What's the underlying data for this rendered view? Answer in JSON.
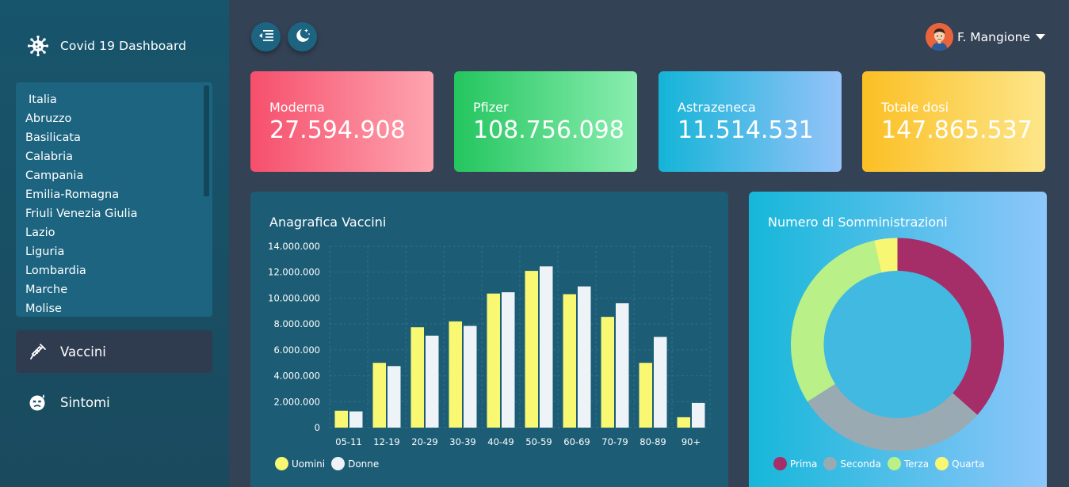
{
  "brand": {
    "title": "Covid 19 Dashboard",
    "icon": "virus-icon"
  },
  "regions": [
    "Italia",
    "Abruzzo",
    "Basilicata",
    "Calabria",
    "Campania",
    "Emilia-Romagna",
    "Friuli Venezia Giulia",
    "Lazio",
    "Liguria",
    "Lombardia",
    "Marche",
    "Molise"
  ],
  "nav": [
    {
      "label": "Vaccini",
      "icon": "syringe-icon",
      "active": true
    },
    {
      "label": "Sintomi",
      "icon": "sick-face-icon",
      "active": false
    }
  ],
  "topbar": {
    "menu_icon": "menu-indent-icon",
    "theme_icon": "moon-stars-icon",
    "user_name": "F. Mangione"
  },
  "cards": [
    {
      "label": "Moderna",
      "value": "27.594.908"
    },
    {
      "label": "Pfizer",
      "value": "108.756.098"
    },
    {
      "label": "Astrazeneca",
      "value": "11.514.531"
    },
    {
      "label": "Totale dosi",
      "value": "147.865.537"
    }
  ],
  "bar_panel": {
    "title": "Anagrafica Vaccini"
  },
  "donut_panel": {
    "title": "Numero di Somministrazioni"
  },
  "colors": {
    "uomini": "#f8f872",
    "donne": "#eef3f8",
    "prima": "#a52e68",
    "seconda": "#9aaab2",
    "terza": "#b9f087",
    "quarta": "#f7f773"
  },
  "chart_data": [
    {
      "type": "bar",
      "categories": [
        "05-11",
        "12-19",
        "20-29",
        "30-39",
        "40-49",
        "50-59",
        "60-69",
        "70-79",
        "80-89",
        "90+"
      ],
      "series": [
        {
          "name": "Uomini",
          "values": [
            1300000,
            5000000,
            7750000,
            8200000,
            10350000,
            12100000,
            10300000,
            8550000,
            5000000,
            800000
          ]
        },
        {
          "name": "Donne",
          "values": [
            1250000,
            4750000,
            7100000,
            7850000,
            10450000,
            12450000,
            10900000,
            9600000,
            7000000,
            1900000
          ]
        }
      ],
      "yticks": [
        "0",
        "2.000.000",
        "4.000.000",
        "6.000.000",
        "8.000.000",
        "10.000.000",
        "12.000.000",
        "14.000.000"
      ],
      "ylim": [
        0,
        14000000
      ],
      "grid": true,
      "legend_position": "bottom-left"
    },
    {
      "type": "pie",
      "labels": [
        "Prima",
        "Seconda",
        "Terza",
        "Quarta"
      ],
      "values": [
        36.5,
        29.5,
        30.5,
        3.5
      ],
      "legend_position": "bottom"
    }
  ]
}
